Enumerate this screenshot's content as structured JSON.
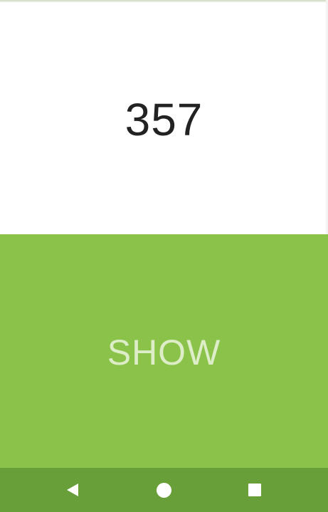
{
  "display": {
    "number": "357"
  },
  "action": {
    "show_label": "SHOW"
  },
  "nav_bar": {
    "back_icon": "back-triangle-icon",
    "home_icon": "home-circle-icon",
    "recents_icon": "recents-square-icon"
  },
  "colors": {
    "button_background": "#8bc34a",
    "button_text": "#dcedc8",
    "nav_bar_background": "#689f38",
    "number_text": "#222222"
  }
}
